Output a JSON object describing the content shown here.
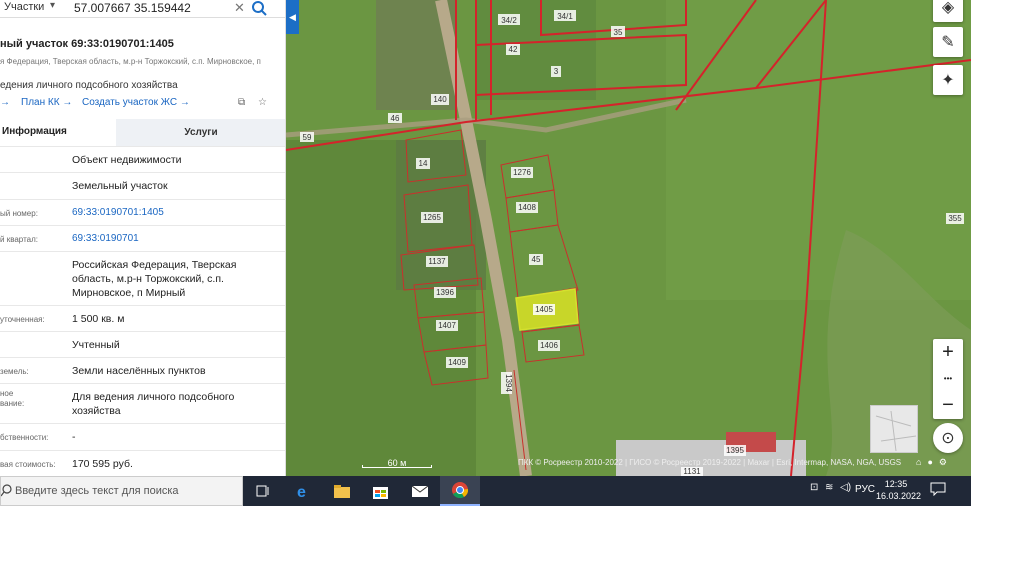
{
  "search": {
    "layer_label": "Участки",
    "chevron": "▾",
    "query": "57.007667 35.159442",
    "clear": "✕"
  },
  "collapse_arrow": "◀",
  "parcel": {
    "title": "ный участок 69:33:0190701:1405",
    "address_short": "я Федерация, Тверская область, м.р-н Торжокский, с.п. Мирновское, п",
    "purpose": "едения личного подсобного хозяйства",
    "links": {
      "first": "→",
      "plan_kk": "План КК →",
      "create_zs": "Создать участок ЖС →"
    }
  },
  "tabs": {
    "info": "Информация",
    "services": "Услуги"
  },
  "info_rows": [
    {
      "label": "",
      "value": "Объект недвижимости",
      "link": false
    },
    {
      "label": "",
      "value": "Земельный участок",
      "link": false
    },
    {
      "label": "ый номер:",
      "value": "69:33:0190701:1405",
      "link": true
    },
    {
      "label": "й квартал:",
      "value": "69:33:0190701",
      "link": true
    },
    {
      "label": "",
      "value": "Российская Федерация, Тверская область, м.р-н Торжокский, с.п. Мирновское, п Мирный",
      "link": false
    },
    {
      "label": "уточненная:",
      "value": "1 500 кв. м",
      "link": false
    },
    {
      "label": "",
      "value": "Учтенный",
      "link": false
    },
    {
      "label": "земель:",
      "value": "Земли населённых пунктов",
      "link": false
    },
    {
      "label": "ное\nвание:",
      "value": "Для ведения личного подсобного хозяйства",
      "link": false
    },
    {
      "label": "бственности:",
      "value": "-",
      "link": false
    },
    {
      "label": "вая стоимость:",
      "value": "170 595 руб.",
      "link": false
    }
  ],
  "map": {
    "scale_label": "60 м",
    "attribution": "ПКК © Росреестр 2010-2022 | ГИСО © Росреестр 2019-2022 | Maxar | Esri, Intermap, NASA, NGA, USGS",
    "zoom_in": "+",
    "zoom_dots": "•••",
    "zoom_out": "−",
    "parcel_labels": [
      {
        "text": "34/2"
      },
      {
        "text": "34/1"
      },
      {
        "text": "35"
      },
      {
        "text": "42"
      },
      {
        "text": "3"
      },
      {
        "text": "140"
      },
      {
        "text": "46"
      },
      {
        "text": "59"
      },
      {
        "text": "14"
      },
      {
        "text": "1276"
      },
      {
        "text": "1408"
      },
      {
        "text": "1265"
      },
      {
        "text": "45"
      },
      {
        "text": "1137"
      },
      {
        "text": "1396"
      },
      {
        "text": "1405"
      },
      {
        "text": "1407"
      },
      {
        "text": "1406"
      },
      {
        "text": "1409"
      },
      {
        "text": "1394"
      },
      {
        "text": "355"
      },
      {
        "text": "1395"
      },
      {
        "text": "1131"
      }
    ],
    "highlight_color": "#c8d629",
    "boundary_color": "#d4232b"
  },
  "taskbar": {
    "search_placeholder": "Введите здесь текст для поиска",
    "language": "РУС",
    "time": "12:35",
    "date": "16.03.2022"
  }
}
